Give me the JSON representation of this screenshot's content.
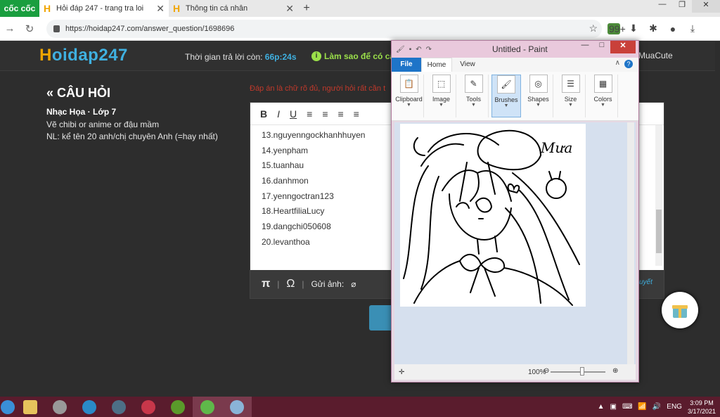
{
  "browser": {
    "brand": "cốc cốc",
    "tabs": [
      {
        "label": "Hỏi đáp 247 - trang tra loi",
        "close": "✕"
      },
      {
        "label": "Thông tin cá nhân",
        "close": "✕"
      }
    ],
    "new_tab": "+",
    "url": "https://hoidap247.com/answer_question/1698696",
    "badge": "99+"
  },
  "site": {
    "logo_h": "H",
    "logo_rest": "oidap247",
    "timer_label": "Thời gian trả lời còn:",
    "timer_value": "66p:24s",
    "howto": "Làm sao để có câ",
    "username": "MuaCute"
  },
  "question": {
    "title": "« CÂU HỎI",
    "meta": "Nhạc Họa · Lớp 7",
    "lines": [
      "Vẽ chibi or anime or đậu mầm",
      "NL: kể tên 20 anh/chị chuyên Anh (=hay nhất)"
    ]
  },
  "answer": {
    "hint": "Đáp án là chữ rõ đủ, người hỏi rất cần t",
    "list": [
      "13.nguyenngockhanhhuyen",
      "14.yenpham",
      "15.tuanhau",
      "16.danhmon",
      "17.yenngoctran123",
      "18.HeartfiliaLucy",
      "19.dangchi050608",
      "20.levanthoa"
    ],
    "toolbar": {
      "bold": "B",
      "italic": "I",
      "underline": "U"
    },
    "footer": {
      "pi": "π",
      "omega": "Ω",
      "sep": "|",
      "send": "Gửi ảnh:",
      "link": "uyết"
    }
  },
  "paint": {
    "title": "Untitled - Paint",
    "tabs": {
      "file": "File",
      "home": "Home",
      "view": "View"
    },
    "ribbon": [
      "Clipboard",
      "Image",
      "Tools",
      "Brushes",
      "Shapes",
      "Size",
      "Colors"
    ],
    "signature": "Mưa",
    "zoom": "100%",
    "help": "?"
  },
  "taskbar": {
    "lang": "ENG",
    "time": "3:09 PM",
    "date": "3/17/2021"
  },
  "colors": {
    "accent": "#3fb0e0",
    "logo_orange": "#f0a500",
    "howto_green": "#9be04a",
    "taskbar": "#5a1c2d",
    "paint_file": "#1e74c8"
  }
}
